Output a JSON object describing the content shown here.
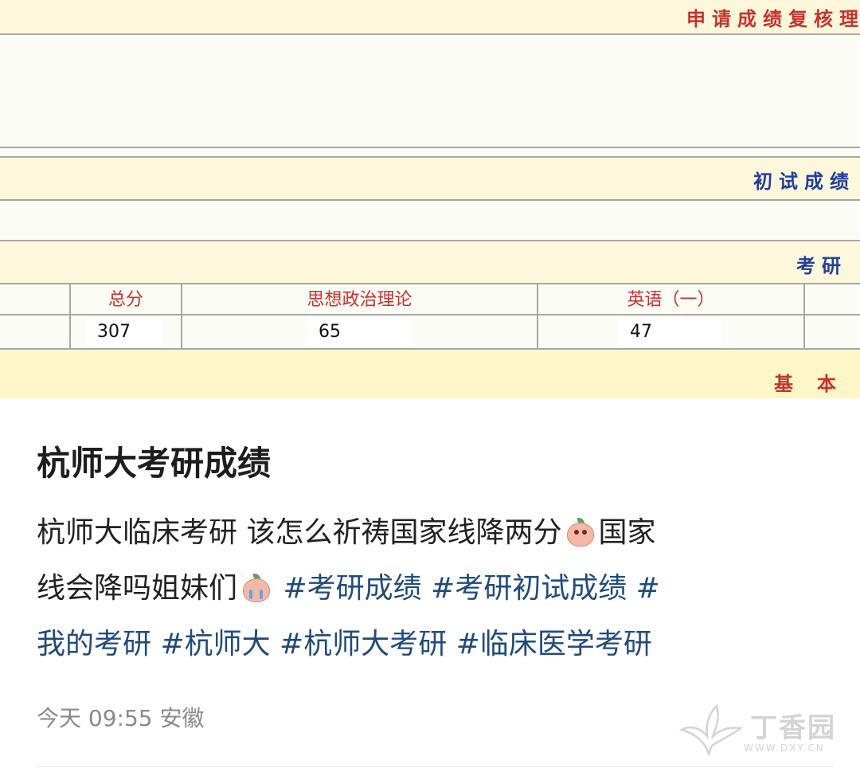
{
  "screenshot": {
    "header_red": "申请成绩复核理",
    "section_blue": "初试成绩",
    "section_blue_right": "考研",
    "table": {
      "headers": [
        "总分",
        "思想政治理论",
        "英语（一）"
      ],
      "values": [
        "307",
        "65",
        "47"
      ]
    },
    "footer_red": "基本"
  },
  "post": {
    "title": "杭师大考研成绩",
    "line1_text": "杭师大临床考研 该怎么祈祷国家线降两分",
    "line1_tail": "国家",
    "line2_text": "线会降吗姐妹们",
    "line2_tags": "#考研成绩 #考研初试成绩 #",
    "line3_tags": "我的考研 #杭师大 #杭师大考研 #临床医学考研",
    "emoji1": "crying-peach-emoji",
    "emoji2": "sobbing-peach-emoji",
    "meta": "今天 09:55 安徽",
    "watermark_text": "丁香园",
    "watermark_url": "WWW.DXY.CN"
  },
  "colors": {
    "red": "#c8312c",
    "blue": "#1f3f9c",
    "band": "#fdf8dc",
    "tag": "#1f4b7c"
  }
}
